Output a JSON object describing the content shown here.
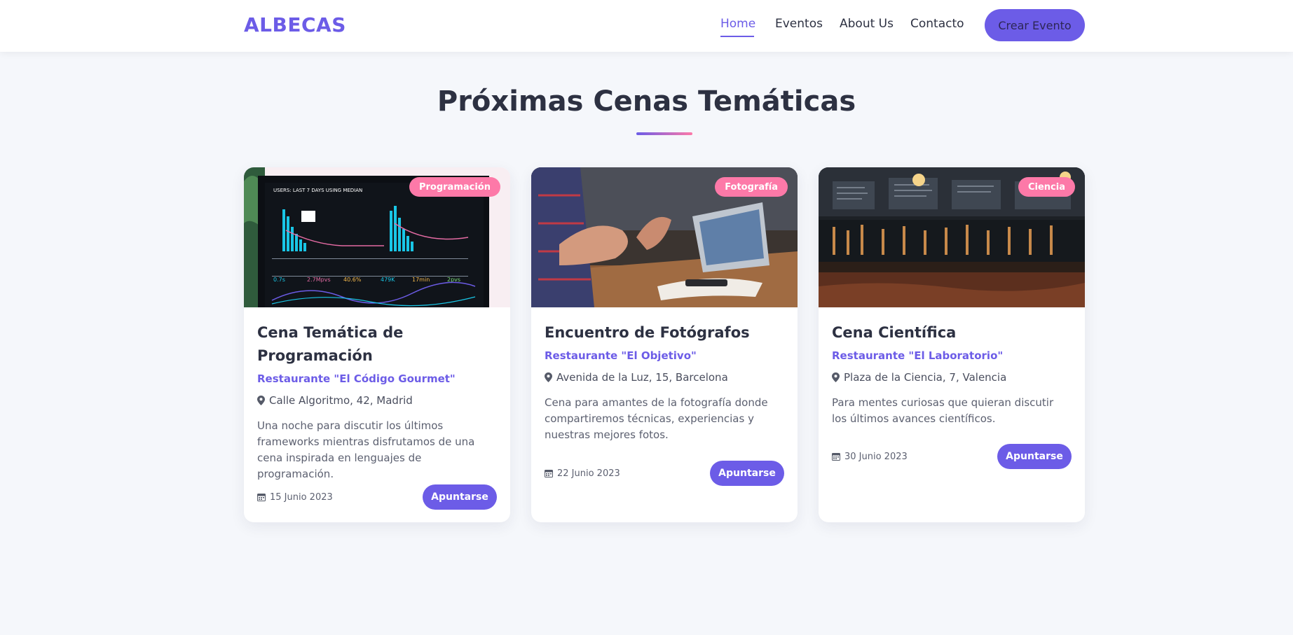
{
  "brand": "ALBECAS",
  "nav": {
    "links": [
      "Home",
      "Eventos",
      "About Us",
      "Contacto"
    ],
    "cta": "Crear Evento"
  },
  "section": {
    "title": "Próximas Cenas Temáticas"
  },
  "cards": [
    {
      "tag": "Programación",
      "title": "Cena Temática de Programación",
      "restaurant": "Restaurante \"El Código Gourmet\"",
      "address": "Calle Algoritmo, 42, Madrid",
      "description": "Una noche para discutir los últimos frameworks mientras disfrutamos de una cena inspirada en lenguajes de programación.",
      "date": "15 Junio 2023",
      "button": "Apuntarse"
    },
    {
      "tag": "Fotografía",
      "title": "Encuentro de Fotógrafos",
      "restaurant": "Restaurante \"El Objetivo\"",
      "address": "Avenida de la Luz, 15, Barcelona",
      "description": "Cena para amantes de la fotografía donde compartiremos técnicas, experiencias y nuestras mejores fotos.",
      "date": "22 Junio 2023",
      "button": "Apuntarse"
    },
    {
      "tag": "Ciencia",
      "title": "Cena Científica",
      "restaurant": "Restaurante \"El Laboratorio\"",
      "address": "Plaza de la Ciencia, 7, Valencia",
      "description": "Para mentes curiosas que quieran discutir los últimos avances científicos.",
      "date": "30 Junio 2023",
      "button": "Apuntarse"
    }
  ],
  "colors": {
    "primary": "#6c5ce7",
    "accent": "#fd79a8",
    "background": "#f5f7fb"
  }
}
